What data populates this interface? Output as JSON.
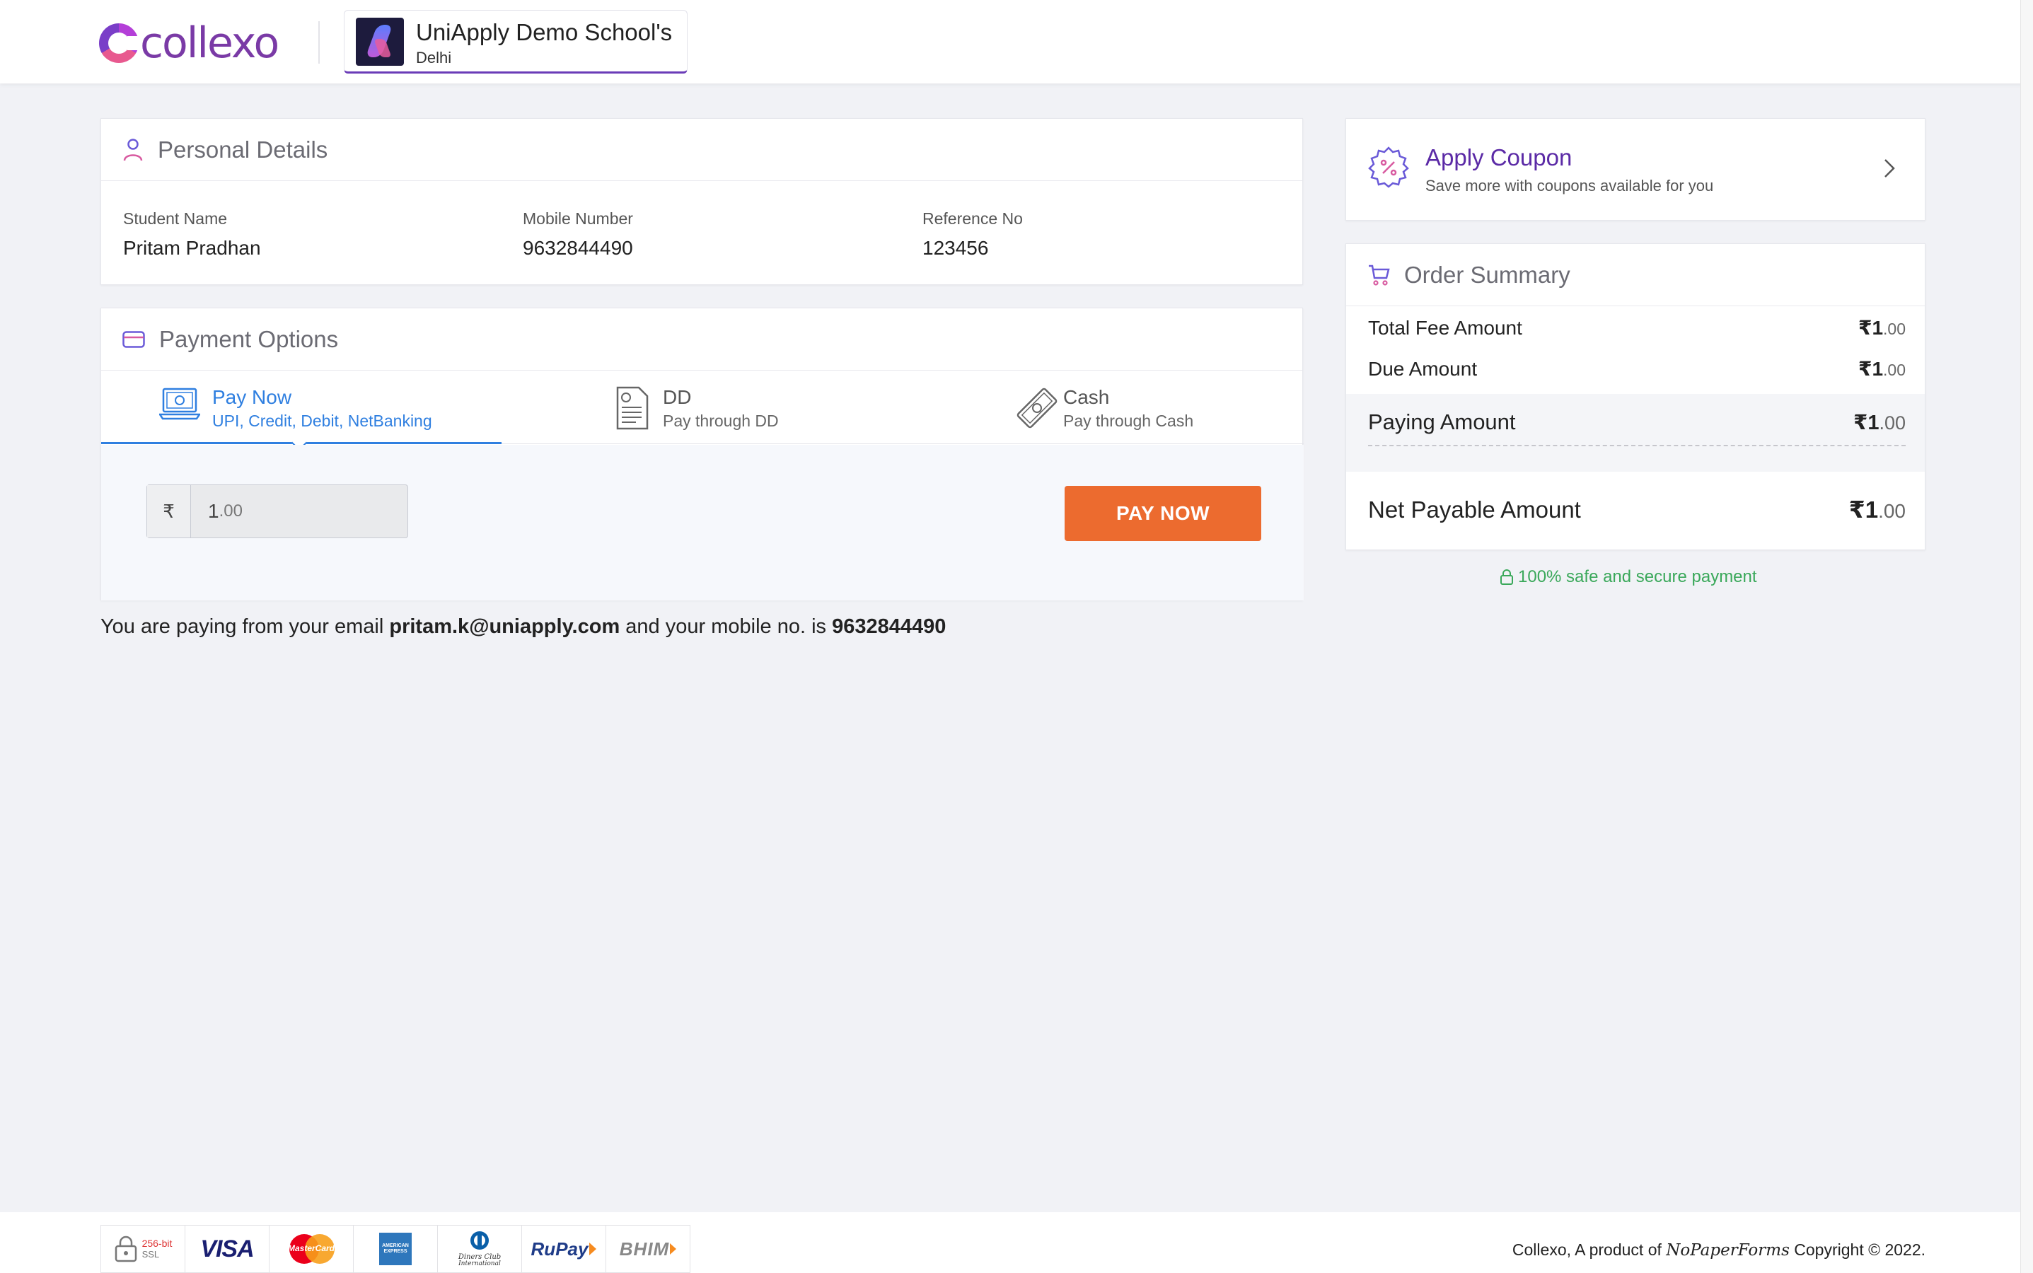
{
  "header": {
    "brand": "collexo",
    "school_name": "UniApply Demo School's",
    "school_city": "Delhi"
  },
  "personal_details": {
    "title": "Personal Details",
    "fields": [
      {
        "label": "Student Name",
        "value": "Pritam Pradhan"
      },
      {
        "label": "Mobile Number",
        "value": "9632844490"
      },
      {
        "label": "Reference No",
        "value": "123456"
      }
    ]
  },
  "payment_options": {
    "title": "Payment Options",
    "tabs": [
      {
        "title": "Pay Now",
        "sub": "UPI, Credit, Debit, NetBanking",
        "active": true
      },
      {
        "title": "DD",
        "sub": "Pay through DD",
        "active": false
      },
      {
        "title": "Cash",
        "sub": "Pay through Cash",
        "active": false
      }
    ],
    "currency_symbol": "₹",
    "amount_int": "1",
    "amount_dec": ".00",
    "pay_button": "PAY NOW"
  },
  "info": {
    "prefix": "You are paying from your email",
    "email": "pritam.k@uniapply.com",
    "middle": "and your mobile no. is",
    "mobile": "9632844490"
  },
  "coupon": {
    "title": "Apply Coupon",
    "subtitle": "Save more with coupons available for you"
  },
  "order_summary": {
    "title": "Order Summary",
    "rows": [
      {
        "label": "Total Fee Amount",
        "cur": "₹",
        "int": "1",
        "dec": ".00"
      },
      {
        "label": "Due Amount",
        "cur": "₹",
        "int": "1",
        "dec": ".00"
      },
      {
        "label": "Paying Amount",
        "cur": "₹",
        "int": "1",
        "dec": ".00"
      },
      {
        "label": "Net Payable Amount",
        "cur": "₹",
        "int": "1",
        "dec": ".00"
      }
    ]
  },
  "secure_text": "100% safe and secure payment",
  "footer": {
    "ssl_top": "256-bit",
    "ssl_bottom": "SSL",
    "visa": "VISA",
    "mastercard": "MasterCard",
    "amex": "AMERICAN EXPRESS",
    "diners_1": "Diners Club",
    "diners_2": "International",
    "rupay": "RuPay",
    "bhim": "BHIM",
    "copyright_prefix": "Collexo, A product of",
    "copyright_brand": "NoPaperForms",
    "copyright_suffix": "Copyright © 2022."
  },
  "colors": {
    "accent_blue": "#2f7fe0",
    "pay_orange": "#ec6b2f",
    "coupon_purple": "#5b2aa6",
    "secure_green": "#3aa85a"
  }
}
